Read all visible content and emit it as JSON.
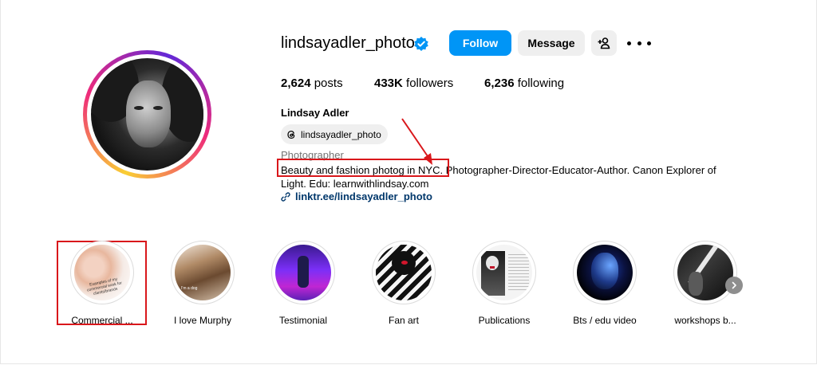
{
  "profile": {
    "username": "lindsayadler_photo",
    "verified": true,
    "follow_label": "Follow",
    "message_label": "Message",
    "posts_count": "2,624",
    "posts_label": "posts",
    "followers_count": "433K",
    "followers_label": "followers",
    "following_count": "6,236",
    "following_label": "following",
    "full_name": "Lindsay Adler",
    "threads_handle": "lindsayadler_photo",
    "category": "Photographer",
    "bio_highlighted": "Beauty and fashion photog in NYC.",
    "bio_rest": " Photographer-Director-Educator-Author. Canon Explorer of Light. Edu: learnwithlindsay.com",
    "link": "linktr.ee/lindsayadler_photo"
  },
  "highlights": [
    {
      "label": "Commercial ...",
      "overlay_text": "Examples of my commercial work for clients/brands"
    },
    {
      "label": "I love Murphy",
      "overlay_text": "I'm a dog"
    },
    {
      "label": "Testimonial",
      "overlay_text": ""
    },
    {
      "label": "Fan art",
      "overlay_text": ""
    },
    {
      "label": "Publications",
      "overlay_text": ""
    },
    {
      "label": "Bts / edu video",
      "overlay_text": ""
    },
    {
      "label": "workshops b...",
      "overlay_text": ""
    }
  ],
  "colors": {
    "follow_blue": "#0095f6",
    "link_blue": "#00376b",
    "annotation_red": "#d9171b"
  },
  "icons": {
    "verified": "verified-badge-icon",
    "add_user": "add-user-icon",
    "more": "more-options-icon",
    "threads": "threads-icon",
    "link": "link-icon",
    "next": "chevron-right-icon"
  }
}
